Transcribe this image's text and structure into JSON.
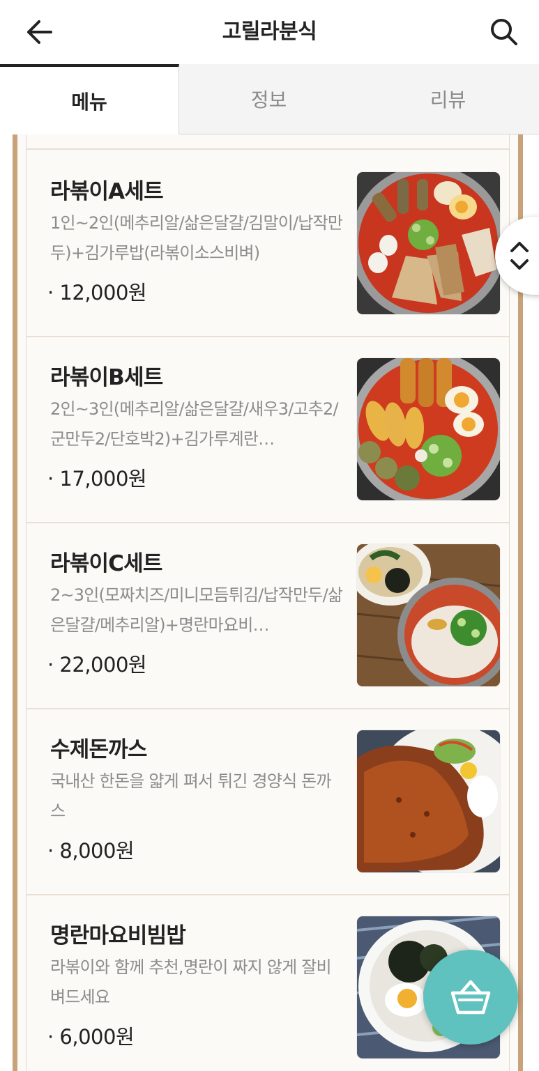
{
  "header": {
    "title": "고릴라분식"
  },
  "tabs": [
    {
      "label": "메뉴",
      "active": true
    },
    {
      "label": "정보",
      "active": false
    },
    {
      "label": "리뷰",
      "active": false
    }
  ],
  "menu_items": [
    {
      "name": "라볶이A세트",
      "description": "1인~2인(메추리알/삶은달걀/김말이/납작만두)+김가루밥(라볶이소스비벼)",
      "price": "· 12,000원"
    },
    {
      "name": "라볶이B세트",
      "description": "2인~3인(메추리알/삶은달걀/새우3/고추2/군만두2/단호박2)+김가루계란…",
      "price": "· 17,000원"
    },
    {
      "name": "라볶이C세트",
      "description": "2~3인(모짜치즈/미니모듬튀김/납작만두/삶은달걀/메추리알)+명란마요비…",
      "price": "· 22,000원"
    },
    {
      "name": "수제돈까스",
      "description": "국내산 한돈을 얇게 펴서 튀긴 경양식 돈까스",
      "price": "· 8,000원"
    },
    {
      "name": "명란마요비빔밥",
      "description": "라볶이와 함께 추천,명란이 짜지 않게 잘비벼드세요",
      "price": "· 6,000원"
    }
  ],
  "colors": {
    "accent_teal": "#5fc2bf",
    "frame_brown": "#c9a27a",
    "text_dark": "#222222",
    "text_gray": "#8c8c8c"
  },
  "icons": {
    "back": "arrow-left-icon",
    "search": "search-icon",
    "scroll": "chevron-up-down-icon",
    "cart": "basket-icon"
  }
}
